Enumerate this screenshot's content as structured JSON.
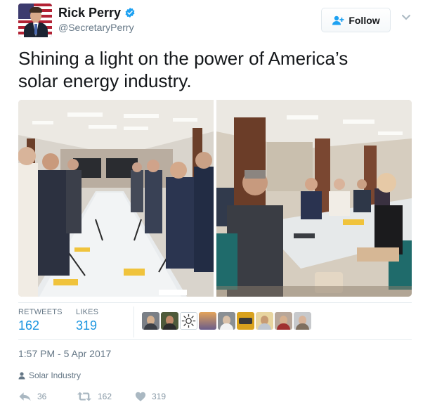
{
  "author": {
    "name": "Rick Perry",
    "handle": "@SecretaryPerry",
    "verified": true
  },
  "follow_button": {
    "label": "Follow"
  },
  "tweet": {
    "text_line1": "Shining a light on the power of America’s",
    "text_line2": "solar energy industry."
  },
  "stats": {
    "retweets_label": "RETWEETS",
    "retweets_value": "162",
    "likes_label": "LIKES",
    "likes_value": "319"
  },
  "timestamp": "1:57 PM - 5 Apr 2017",
  "location": "Solar Industry",
  "actions": {
    "reply_count": "36",
    "retweet_count": "162",
    "like_count": "319"
  },
  "colors": {
    "accent": "#1b95e0",
    "muted": "#657786",
    "text": "#14171a",
    "verified": "#1da1f2"
  },
  "icons": {
    "verified": "verified-badge-icon",
    "follow": "add-user-icon",
    "caret": "chevron-down-icon",
    "location": "location-pin-icon",
    "reply": "reply-icon",
    "retweet": "retweet-icon",
    "like": "heart-icon"
  }
}
